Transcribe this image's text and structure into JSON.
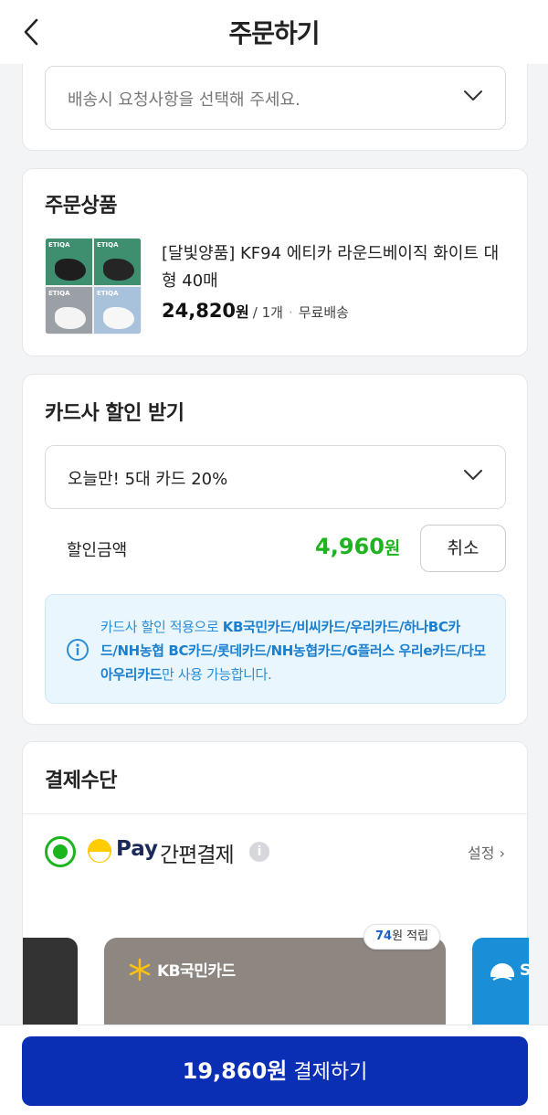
{
  "header": {
    "title": "주문하기"
  },
  "delivery": {
    "request_placeholder": "배송시 요청사항을 선택해 주세요."
  },
  "order": {
    "section_title": "주문상품",
    "product_name": "[달빛양품] KF94 에티카 라운드베이직 화이트 대형 40매",
    "price": "24,820",
    "price_unit": "원",
    "quantity": "/ 1개",
    "shipping": "무료배송",
    "image_brand": "ETIQA"
  },
  "card_discount": {
    "section_title": "카드사 할인 받기",
    "selected_option": "오늘만! 5대 카드 20%",
    "amount_label": "할인금액",
    "amount_value": "4,960",
    "amount_unit": "원",
    "cancel_label": "취소",
    "notice_prefix": "카드사 할인 적용으로 ",
    "notice_cards": "KB국민카드/비씨카드/우리카드/하나BC카드/NH농협 BC카드/롯데카드/NH농협카드/G플러스 우리e카드/다모아우리카드",
    "notice_suffix": "만 사용 가능합니다."
  },
  "payment": {
    "section_title": "결제수단",
    "pay_word": "Pay",
    "pay_name": "간편결제",
    "help_glyph": "i",
    "settings_label": "설정",
    "settings_chevron": "›",
    "reward_amount": "74",
    "reward_unit": "원 적립",
    "kb_card_name": "KB국민카드",
    "next_card_letter": "S"
  },
  "checkout": {
    "amount": "19,860원",
    "label": "결제하기"
  },
  "colors": {
    "primary": "#0a2fb5",
    "discount_green": "#1fb31f",
    "info_blue": "#2a8fd6",
    "radio_green": "#1db51d",
    "pay_yellow": "#ffcc00",
    "kb_card": "#8e8781"
  }
}
